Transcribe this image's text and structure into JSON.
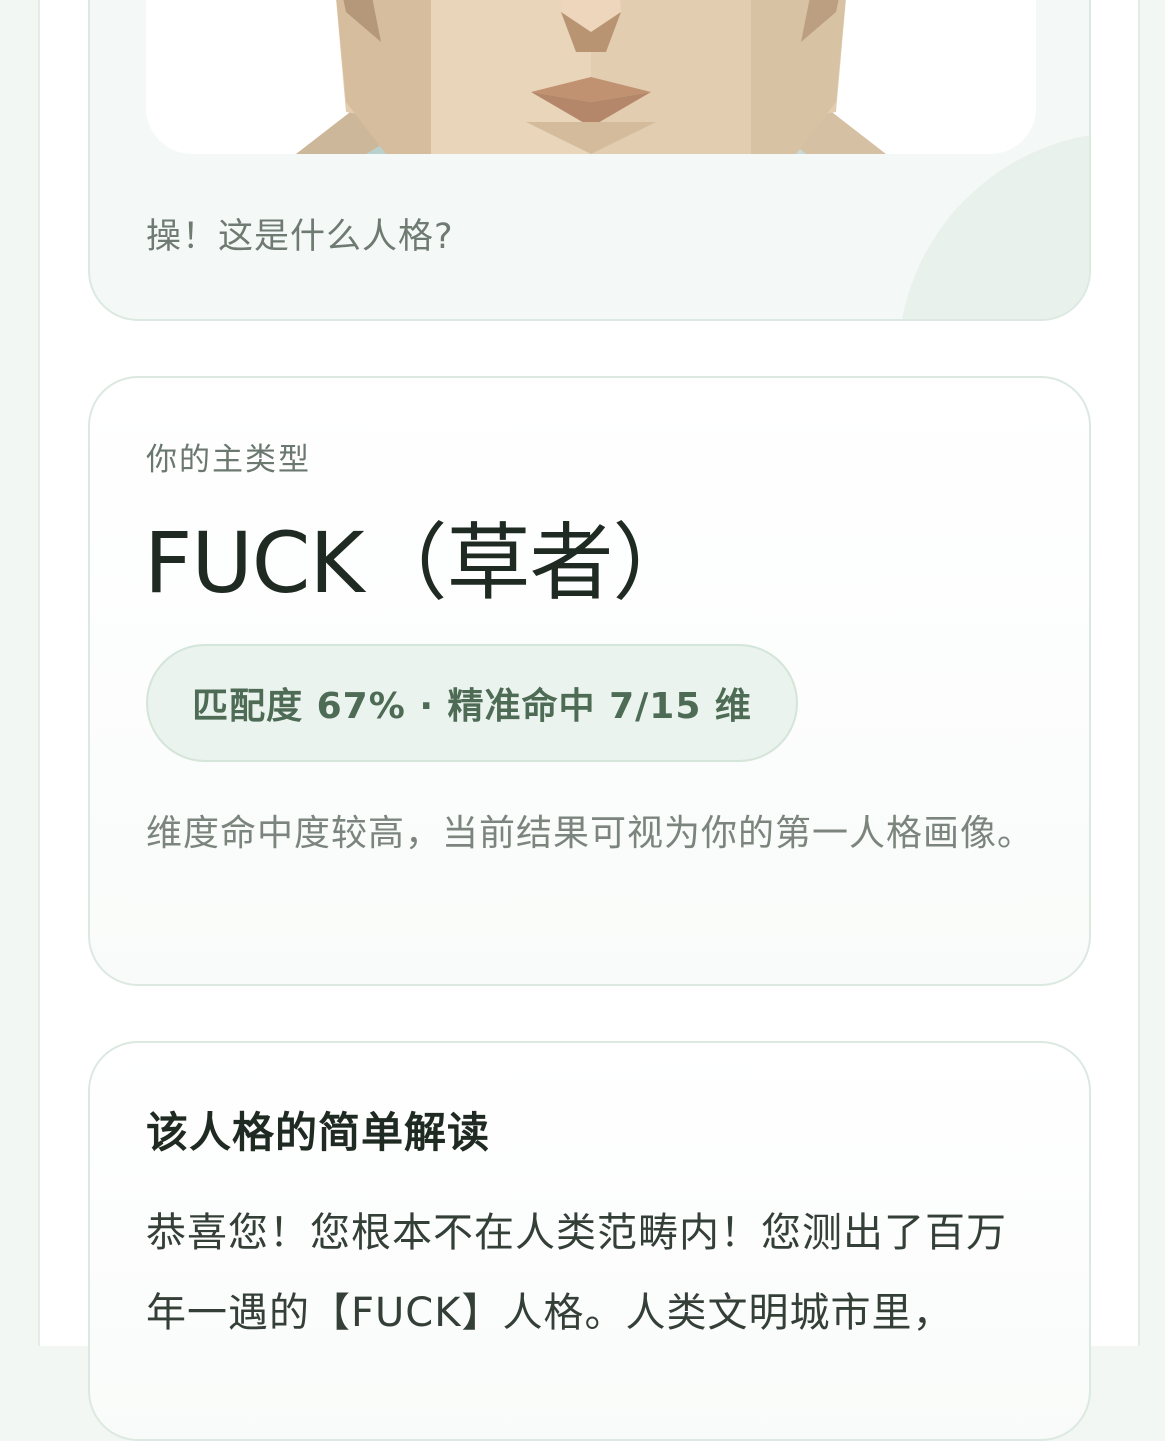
{
  "hero": {
    "caption": "操！这是什么人格?"
  },
  "result": {
    "eyebrow": "你的主类型",
    "type_title": "FUCK（草者）",
    "match_summary": "匹配度 67% · 精准命中 7/15 维",
    "description": "维度命中度较高，当前结果可视为你的第一人格画像。"
  },
  "reading": {
    "title": "该人格的简单解读",
    "body": "恭喜您！您根本不在人类范畴内！您测出了百万年一遇的【FUCK】人格。人类文明城市里，"
  },
  "colors": {
    "accent_green": "#4e6b55",
    "pill_bg": "#eaf3ed",
    "card_border": "#dce9e1",
    "page_bg": "#f3f7f4"
  }
}
